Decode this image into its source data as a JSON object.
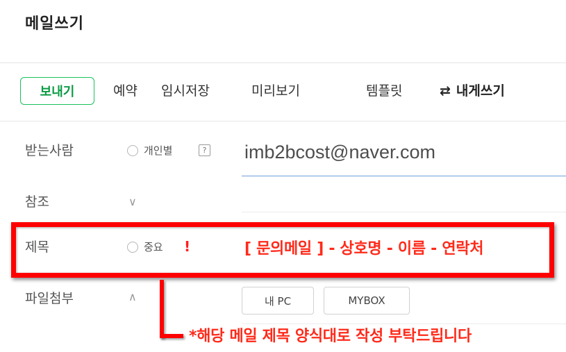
{
  "page": {
    "title": "메일쓰기"
  },
  "toolbar": {
    "send_label": "보내기",
    "reserve_label": "예약",
    "draft_label": "임시저장",
    "preview_label": "미리보기",
    "template_label": "템플릿",
    "self_icon": "⇄",
    "self_label": "내게쓰기"
  },
  "recipient": {
    "label": "받는사람",
    "individual_label": "개인별",
    "help_icon": "?",
    "value": "imb2bcost@naver.com"
  },
  "cc": {
    "label": "참조",
    "chevron": "∨"
  },
  "subject": {
    "label": "제목",
    "important_label": "중요",
    "important_mark": "!",
    "example_text": "[ 문의메일 ] - 상호명 - 이름 - 연락처"
  },
  "attachment": {
    "label": "파일첨부",
    "chevron": "∧",
    "my_pc_label": "내 PC",
    "mybox_label": "MYBOX"
  },
  "annotation": {
    "note": "*해당 메일 제목 양식대로 작성 부탁드립니다",
    "color": "#ff0000"
  },
  "colors": {
    "accent_green": "#19c15a",
    "highlight_red": "#ff0000",
    "underline_blue": "#6f9fd8"
  }
}
